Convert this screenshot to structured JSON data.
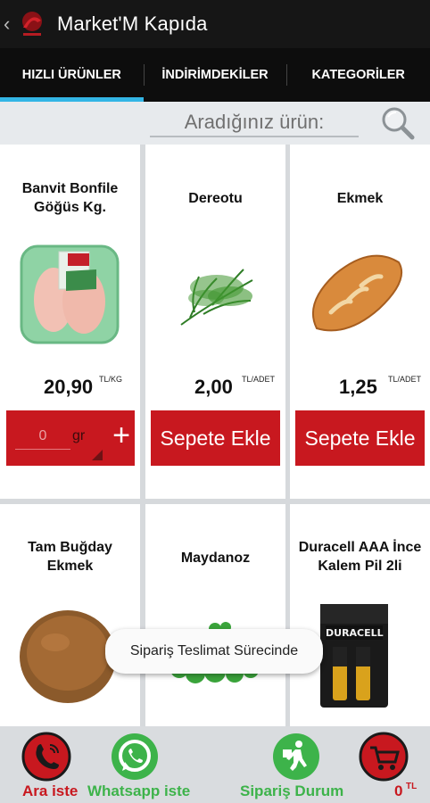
{
  "appbar": {
    "back_icon": "chevron-left-icon",
    "logo_icon": "market-logo-icon",
    "title": "Market'M Kapıda"
  },
  "tabs": [
    {
      "label": "HIZLI ÜRÜNLER",
      "active": true
    },
    {
      "label": "İNDİRİMDEKİLER",
      "active": false
    },
    {
      "label": "KATEGORİLER",
      "active": false
    }
  ],
  "search": {
    "placeholder": "Aradığınız ürün:",
    "value": "",
    "icon": "search-icon"
  },
  "products": [
    {
      "name": "Banvit Bonfile Göğüs Kg.",
      "price": "20,90",
      "unit": "TL/KG",
      "image": "chicken-breast-package",
      "control": "quantity",
      "quantity": "0",
      "quantity_unit": "gr",
      "plus": "+"
    },
    {
      "name": "Dereotu",
      "price": "2,00",
      "unit": "TL/ADET",
      "image": "dill-bunch",
      "control": "button",
      "button_label": "Sepete Ekle"
    },
    {
      "name": "Ekmek",
      "price": "1,25",
      "unit": "TL/ADET",
      "image": "bread-loaf",
      "control": "button",
      "button_label": "Sepete Ekle"
    },
    {
      "name": "Tam Buğday Ekmek",
      "image": "whole-wheat-bread"
    },
    {
      "name": "Maydanoz",
      "image": "parsley-bunch"
    },
    {
      "name": "Duracell AAA İnce Kalem Pil 2li",
      "image": "duracell-battery-pack",
      "image_text": "DURACELL"
    }
  ],
  "toast": {
    "text": "Sipariş Teslimat Sürecinde"
  },
  "bottombar": {
    "call": {
      "label": "Ara iste",
      "icon": "phone-icon"
    },
    "whatsapp": {
      "label": "Whatsapp iste",
      "icon": "whatsapp-icon"
    },
    "order_status": {
      "label": "Sipariş Durum",
      "icon": "delivery-person-icon"
    },
    "cart": {
      "count": "0",
      "currency": "TL",
      "icon": "shopping-cart-icon"
    }
  },
  "colors": {
    "brand_red": "#c8181f",
    "tab_indicator": "#33b5e5",
    "whatsapp_green": "#3db34a"
  }
}
